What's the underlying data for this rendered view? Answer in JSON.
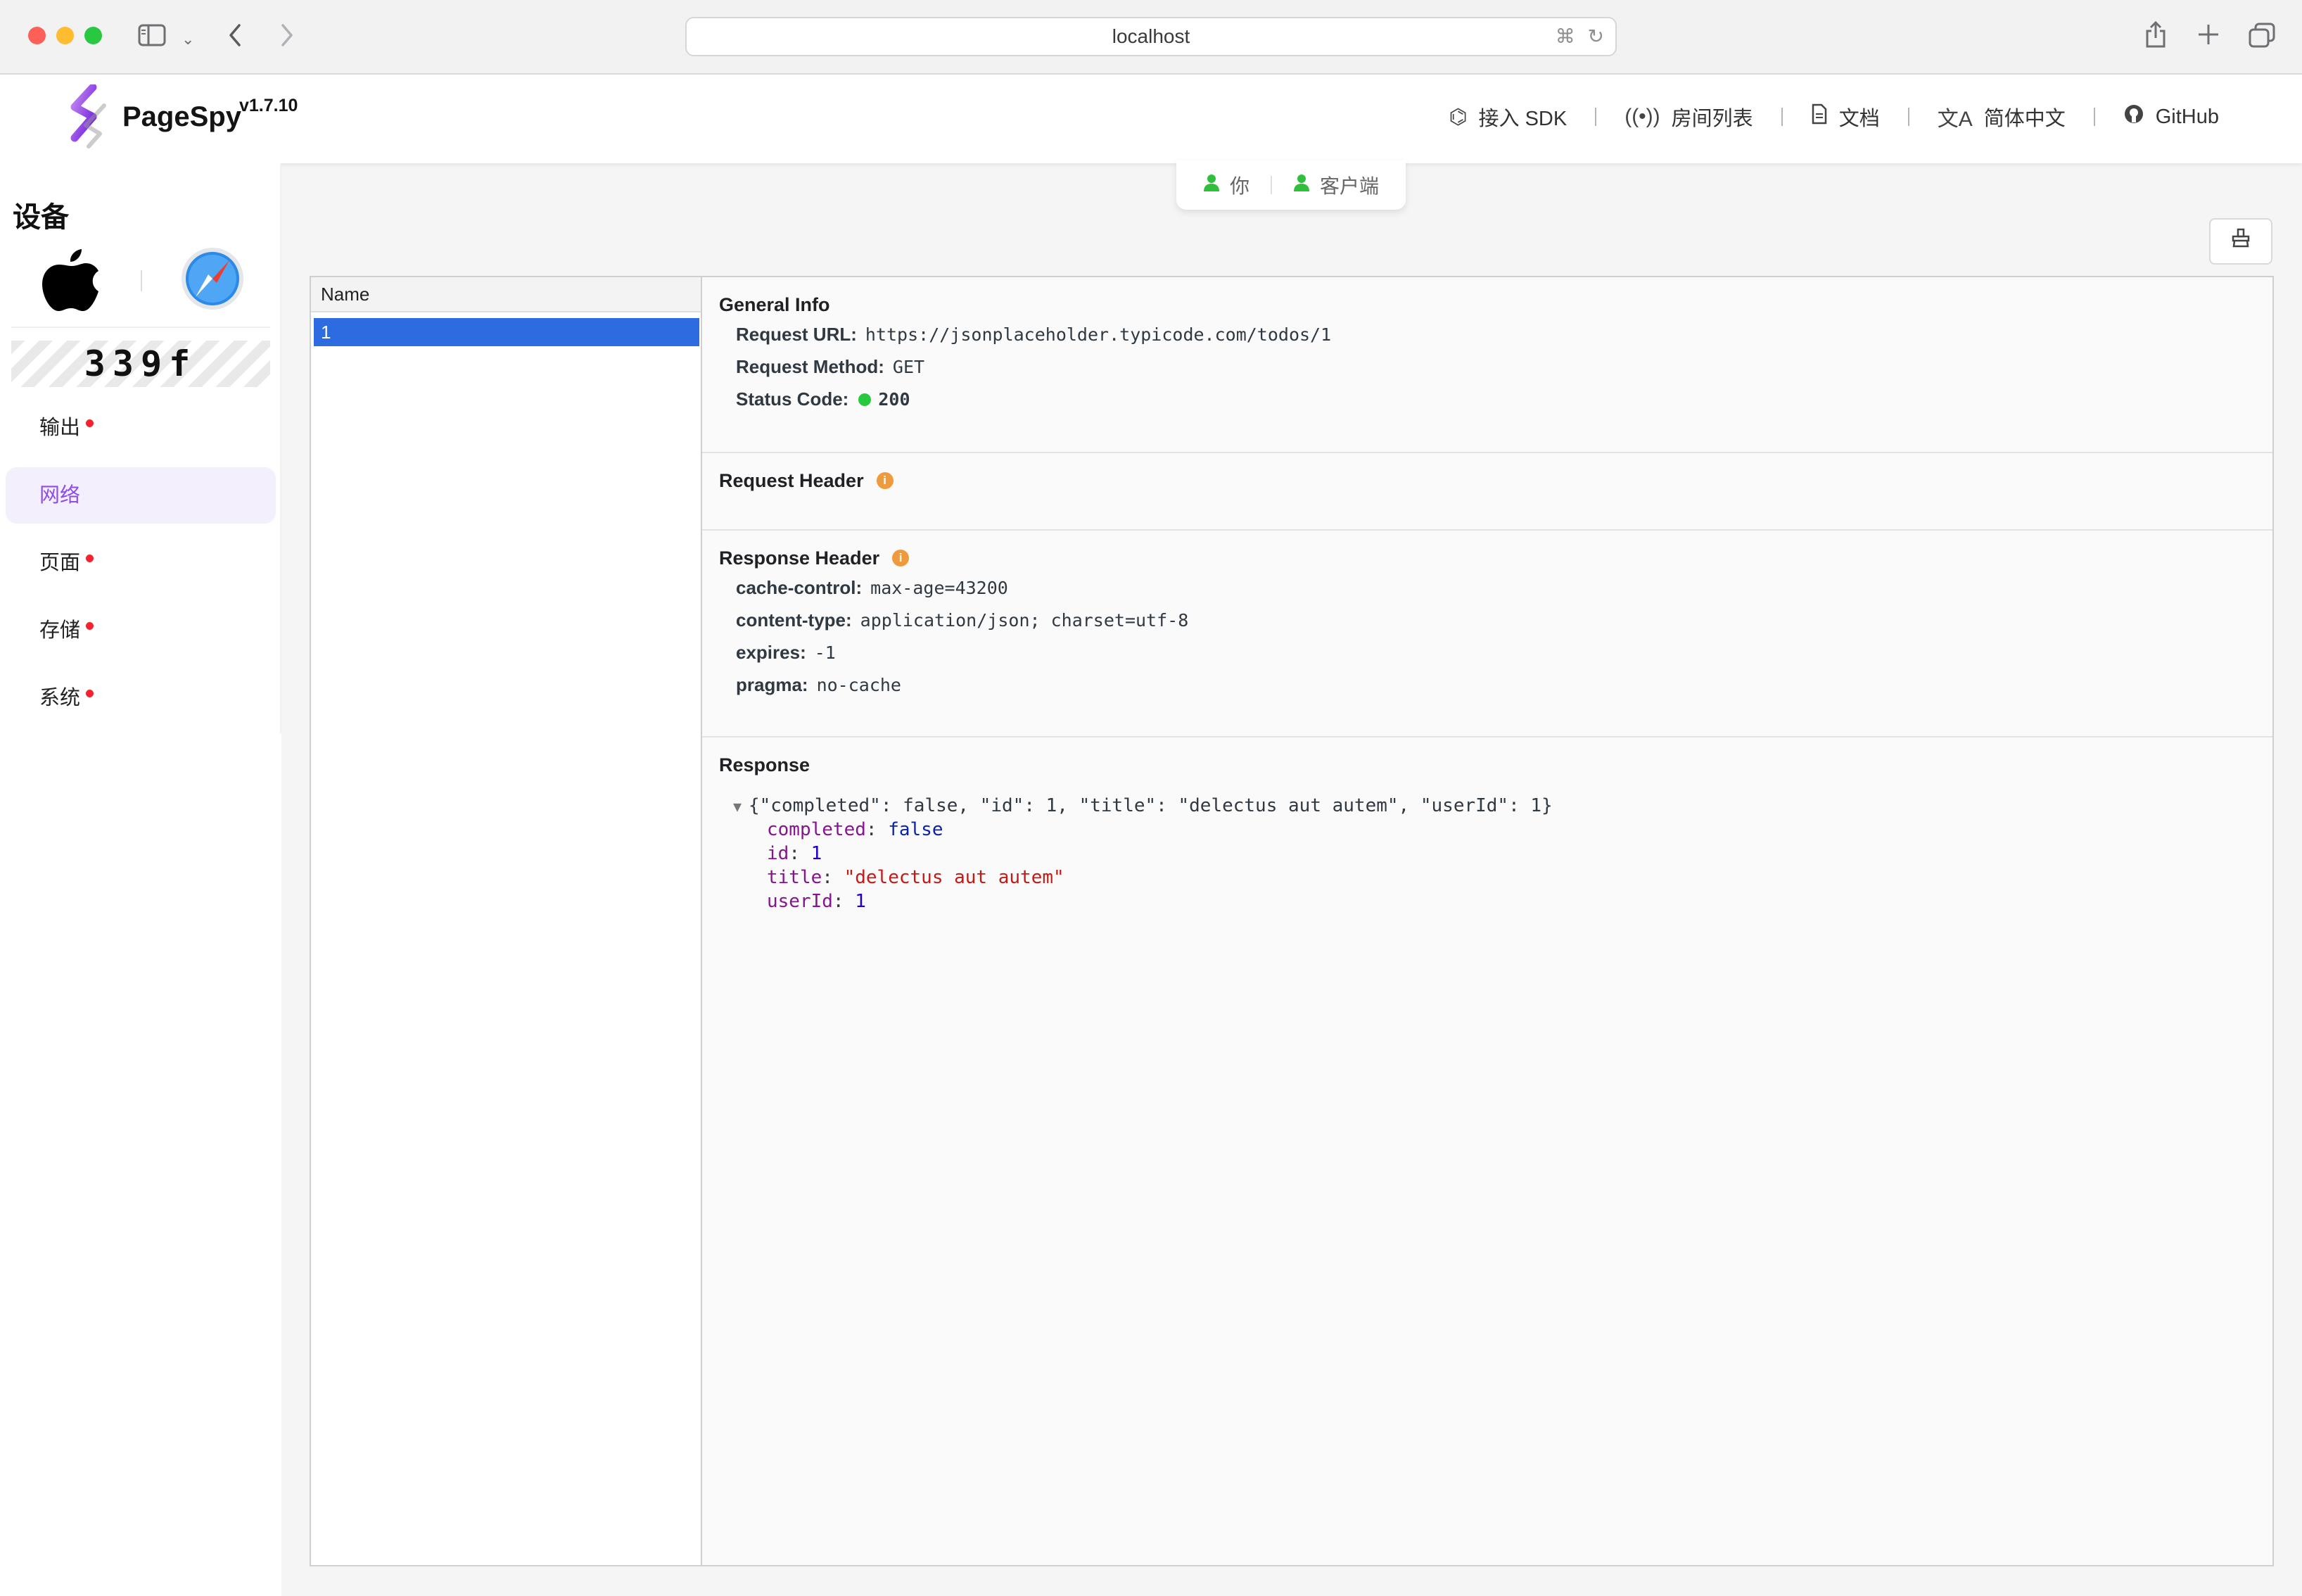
{
  "browser": {
    "url": "localhost",
    "icons": [
      "sidebar-toggle-icon",
      "chevron-down-icon",
      "back-icon",
      "forward-icon",
      "translate-icon",
      "reload-icon",
      "share-icon",
      "new-tab-icon",
      "tabs-overview-icon"
    ]
  },
  "header": {
    "brand": "PageSpy",
    "version": "v1.7.10",
    "nav": [
      {
        "label": "接入 SDK",
        "icon": "sdk-icon"
      },
      {
        "label": "房间列表",
        "icon": "broadcast-icon"
      },
      {
        "label": "文档",
        "icon": "document-icon"
      },
      {
        "label": "简体中文",
        "icon": "translate-icon"
      },
      {
        "label": "GitHub",
        "icon": "github-icon"
      }
    ]
  },
  "sidebar": {
    "title": "设备",
    "device_id": "339f",
    "os_icon": "apple-icon",
    "browser_icon": "safari-icon",
    "menu": [
      {
        "label": "输出",
        "dot": true,
        "active": false
      },
      {
        "label": "网络",
        "dot": false,
        "active": true
      },
      {
        "label": "页面",
        "dot": true,
        "active": false
      },
      {
        "label": "存储",
        "dot": true,
        "active": false
      },
      {
        "label": "系统",
        "dot": true,
        "active": false
      }
    ]
  },
  "connection": {
    "you": "你",
    "client": "客户端"
  },
  "network": {
    "list_header": "Name",
    "requests": [
      "1"
    ],
    "general": {
      "title": "General Info",
      "url_label": "Request URL:",
      "url": "https://jsonplaceholder.typicode.com/todos/1",
      "method_label": "Request Method:",
      "method": "GET",
      "status_label": "Status Code:",
      "status": "200"
    },
    "request_header": {
      "title": "Request Header",
      "info_icon": "i"
    },
    "response_header": {
      "title": "Response Header",
      "info_icon": "i",
      "rows": [
        {
          "k": "cache-control:",
          "v": "max-age=43200"
        },
        {
          "k": "content-type:",
          "v": "application/json; charset=utf-8"
        },
        {
          "k": "expires:",
          "v": "-1"
        },
        {
          "k": "pragma:",
          "v": "no-cache"
        }
      ]
    },
    "response": {
      "title": "Response",
      "summary": "{\"completed\": false, \"id\": 1, \"title\": \"delectus aut autem\", \"userId\": 1}",
      "fields": [
        {
          "k": "completed",
          "v": "false",
          "type": "bool"
        },
        {
          "k": "id",
          "v": "1",
          "type": "num"
        },
        {
          "k": "title",
          "v": "\"delectus aut autem\"",
          "type": "str"
        },
        {
          "k": "userId",
          "v": "1",
          "type": "num"
        }
      ]
    }
  },
  "colors": {
    "accent": "#8d4de8",
    "selected_row": "#2d6be1",
    "status_ok": "#27c93f",
    "dot_red": "#f5222d",
    "info_orange": "#f09a3e"
  }
}
